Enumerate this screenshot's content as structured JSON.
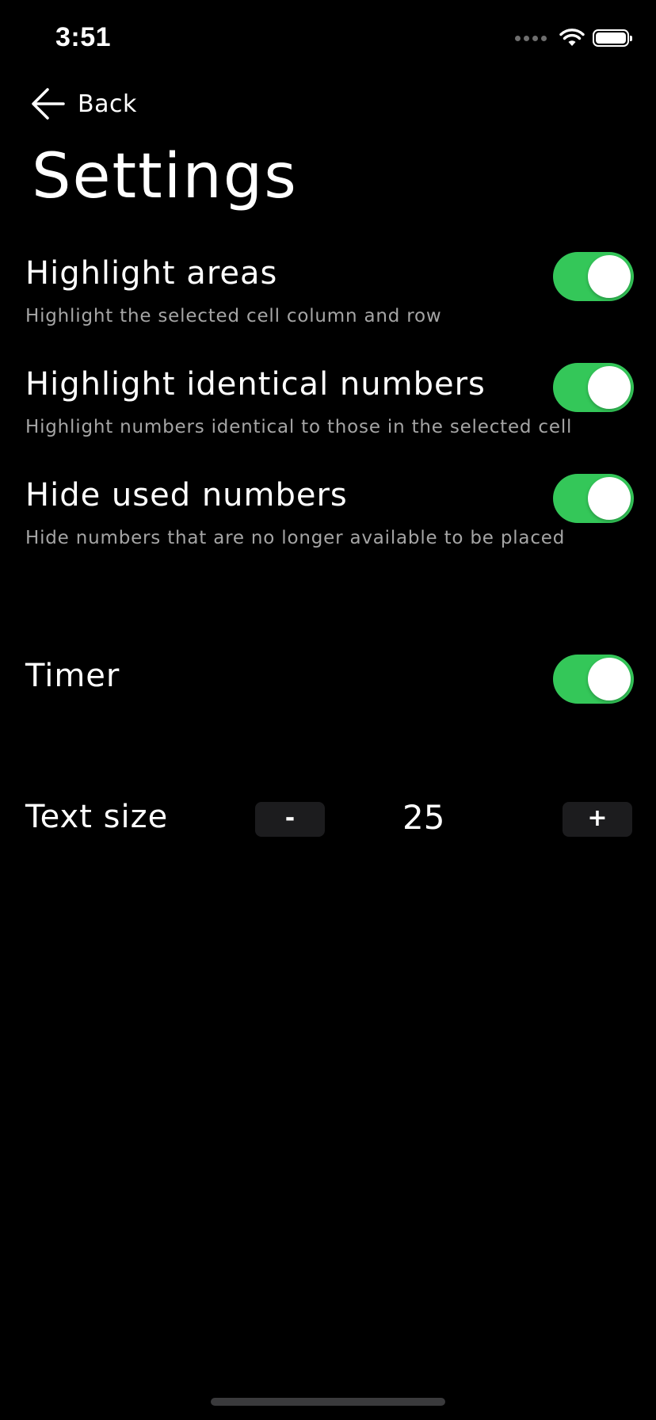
{
  "status_bar": {
    "time": "3:51",
    "icons": [
      "signal-dots-icon",
      "wifi-icon",
      "battery-icon"
    ]
  },
  "nav": {
    "back_label": "Back",
    "back_icon": "arrow-left-icon"
  },
  "page": {
    "title": "Settings"
  },
  "settings": [
    {
      "label": "Highlight areas",
      "description": "Highlight the selected cell column and row",
      "enabled": true
    },
    {
      "label": "Highlight identical numbers",
      "description": "Highlight numbers identical to those in the selected cell",
      "enabled": true
    },
    {
      "label": "Hide used numbers",
      "description": "Hide numbers that are no longer available to be placed",
      "enabled": true
    },
    {
      "label": "Timer",
      "enabled": true
    }
  ],
  "text_size": {
    "label": "Text size",
    "minus_label": "-",
    "plus_label": "+",
    "value": "25"
  },
  "colors": {
    "background": "#000000",
    "toggle_on": "#34c759",
    "description_text": "#a5a5a5",
    "stepper_bg": "#1c1c1e"
  }
}
